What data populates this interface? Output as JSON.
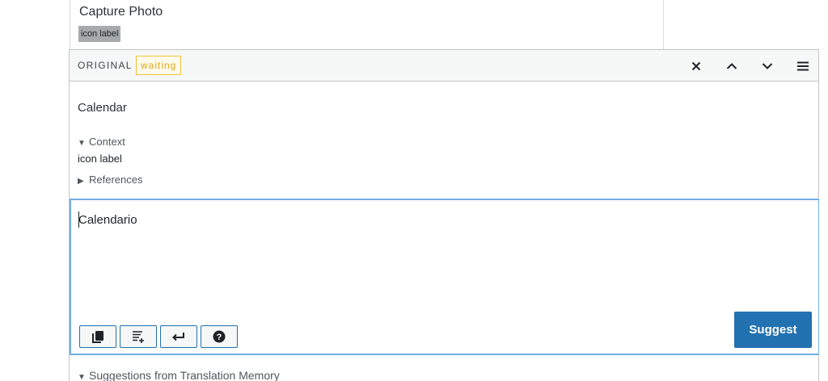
{
  "previous_row": {
    "title": "Capture Photo",
    "tag": "icon label"
  },
  "toolbar": {
    "original_label": "ORIGINAL",
    "status": "waiting",
    "close_icon": "close-icon",
    "prev_icon": "chevron-up-icon",
    "next_icon": "chevron-down-icon",
    "menu_icon": "menu-icon"
  },
  "original": {
    "text": "Calendar"
  },
  "context": {
    "toggle_label": "Context",
    "value": "icon label"
  },
  "references": {
    "toggle_label": "References"
  },
  "translation": {
    "value": "Calendario"
  },
  "actions": {
    "copy_icon": "copy-icon",
    "insert_original_icon": "insert-original-icon",
    "newline_icon": "newline-icon",
    "help_icon": "help-icon",
    "suggest_label": "Suggest"
  },
  "suggestions": {
    "toggle_label": "Suggestions from Translation Memory"
  },
  "colors": {
    "accent": "#2271b1",
    "focus_border": "#72aee6",
    "waiting": "#dba617"
  }
}
